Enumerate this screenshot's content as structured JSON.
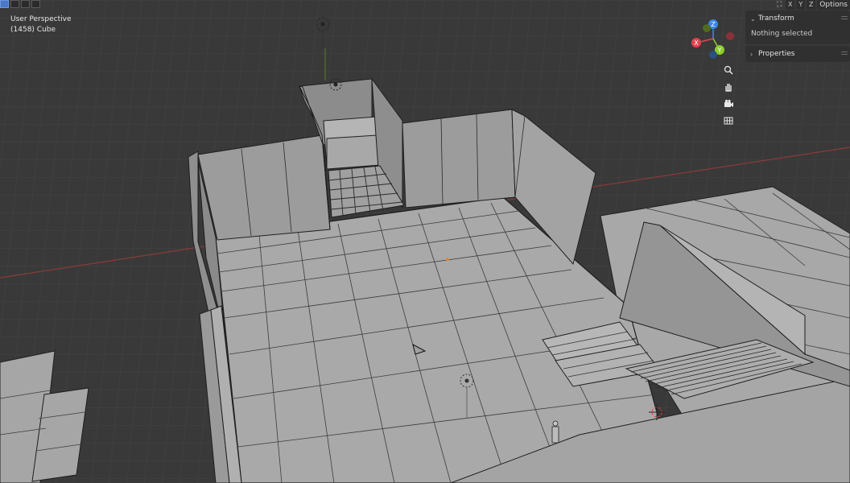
{
  "viewport": {
    "perspective_label": "User Perspective",
    "object_info": "(1458) Cube"
  },
  "header": {
    "left_icons": [
      "select-box-icon",
      "select-extend-icon",
      "select-subtract-icon",
      "select-intersect-icon"
    ],
    "snap_icon": "snap-icon",
    "axis_buttons": [
      "X",
      "Y",
      "Z"
    ],
    "options_label": "Options"
  },
  "gizmo": {
    "z_label": "Z",
    "x_label": "X",
    "y_label": "Y",
    "colors": {
      "x": "#e3424f",
      "y": "#8ccc2b",
      "z": "#3a86e8",
      "neg_x": "#8a3137",
      "neg_y": "#4f6b21",
      "neg_z": "#2b4f80"
    }
  },
  "nav_buttons": [
    {
      "name": "zoom-icon",
      "glyph": "⚲"
    },
    {
      "name": "pan-hand-icon",
      "glyph": "✋"
    },
    {
      "name": "camera-icon",
      "glyph": "🎥"
    },
    {
      "name": "grid-icon",
      "glyph": "▦"
    }
  ],
  "sidebar": {
    "transform": {
      "title": "Transform",
      "body": "Nothing selected",
      "expanded": true
    },
    "properties": {
      "title": "Properties",
      "expanded": false
    }
  },
  "colors": {
    "background": "#393939",
    "grid": "#444444",
    "x_axis": "#8c3a3a",
    "mesh_face": "#a6a6a6",
    "wall_face": "#9a9a9a",
    "edge": "#1e1e1e"
  }
}
